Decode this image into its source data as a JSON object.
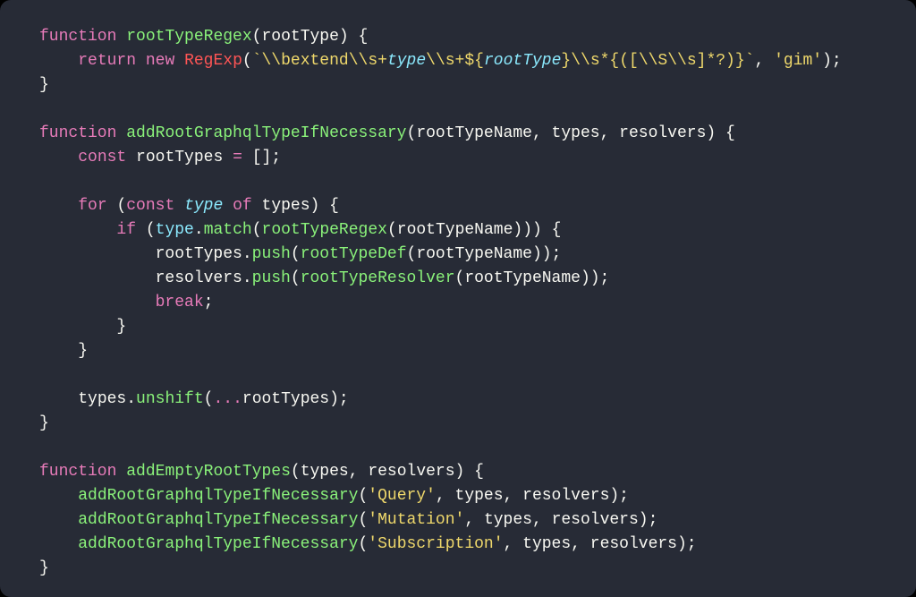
{
  "kw": {
    "function": "function",
    "return": "return",
    "new": "new",
    "const": "const",
    "for": "for",
    "of": "of",
    "if": "if",
    "break": "break"
  },
  "cls": {
    "RegExp": "RegExp"
  },
  "fn": {
    "rootTypeRegex": "rootTypeRegex",
    "addRootGraphqlTypeIfNecessary": "addRootGraphqlTypeIfNecessary",
    "match": "match",
    "push": "push",
    "rootTypeDef": "rootTypeDef",
    "rootTypeResolver": "rootTypeResolver",
    "unshift": "unshift",
    "addEmptyRootTypes": "addEmptyRootTypes"
  },
  "id": {
    "rootType": "rootType",
    "rootTypeName": "rootTypeName",
    "types": "types",
    "resolvers": "resolvers",
    "rootTypes": "rootTypes",
    "type": "type"
  },
  "tmpl": {
    "p1": "\\\\bextend\\\\s+",
    "word_type": "type",
    "p2": "\\\\s+",
    "p3": "\\\\s*{([\\\\S\\\\s]*?)}"
  },
  "str": {
    "gim": "'gim'",
    "Query": "'Query'",
    "Mutation": "'Mutation'",
    "Subscription": "'Subscription'"
  },
  "chart_data": null
}
